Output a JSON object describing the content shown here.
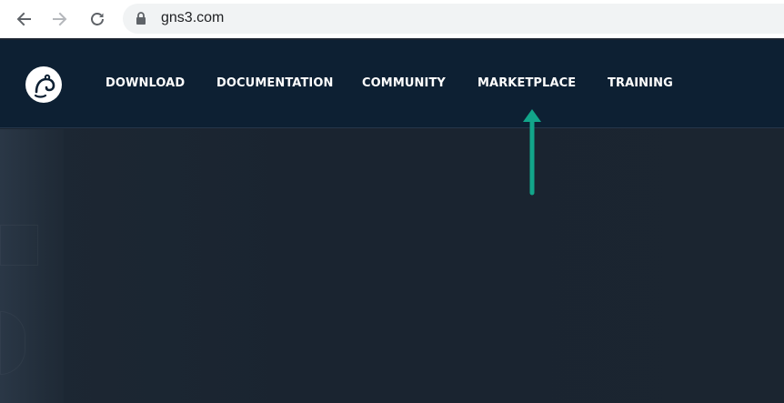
{
  "browser": {
    "url": "gns3.com",
    "icons": [
      "back-arrow-icon",
      "forward-arrow-icon",
      "reload-icon",
      "lock-icon"
    ]
  },
  "site": {
    "logo_icon": "gns3-chameleon-logo",
    "menu": [
      {
        "label": "DOWNLOAD"
      },
      {
        "label": "DOCUMENTATION"
      },
      {
        "label": "COMMUNITY"
      },
      {
        "label": "MARKETPLACE"
      },
      {
        "label": "TRAINING"
      }
    ]
  },
  "annotation": {
    "icon": "up-arrow-icon",
    "color": "#12a58a"
  },
  "colors": {
    "header_bg": "#0d2033",
    "hero_bg": "#1b2430",
    "menu_text": "#ffffff"
  }
}
